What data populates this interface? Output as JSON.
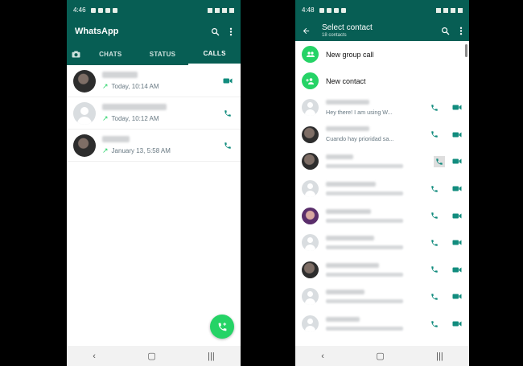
{
  "left": {
    "status_bar": {
      "time": "4:46"
    },
    "app_title": "WhatsApp",
    "tabs": [
      {
        "label": "CHATS"
      },
      {
        "label": "STATUS"
      },
      {
        "label": "CALLS",
        "active": true
      }
    ],
    "calls": [
      {
        "time": "Today, 10:14 AM",
        "direction": "outgoing",
        "type": "video-icon"
      },
      {
        "time": "Today, 10:12 AM",
        "direction": "outgoing",
        "type": "phone-icon"
      },
      {
        "time": "January 13, 5:58 AM",
        "direction": "outgoing",
        "type": "phone-icon"
      }
    ],
    "fab_icon": "add-call-icon"
  },
  "right": {
    "status_bar": {
      "time": "4:48"
    },
    "title": "Select contact",
    "subtitle": "18 contacts",
    "actions": [
      {
        "label": "New group call",
        "icon": "group-icon"
      },
      {
        "label": "New contact",
        "icon": "add-person-icon"
      }
    ],
    "contacts": [
      {
        "status": "Hey there! I am using W..."
      },
      {
        "status": "Cuando hay prioridad sa..."
      },
      {
        "status": ""
      },
      {
        "status": ""
      },
      {
        "status": ""
      },
      {
        "status": ""
      },
      {
        "status": ""
      },
      {
        "status": ""
      },
      {
        "status": ""
      }
    ]
  },
  "colors": {
    "header": "#075e54",
    "accent": "#25d366",
    "icon_teal": "#128c7e"
  }
}
